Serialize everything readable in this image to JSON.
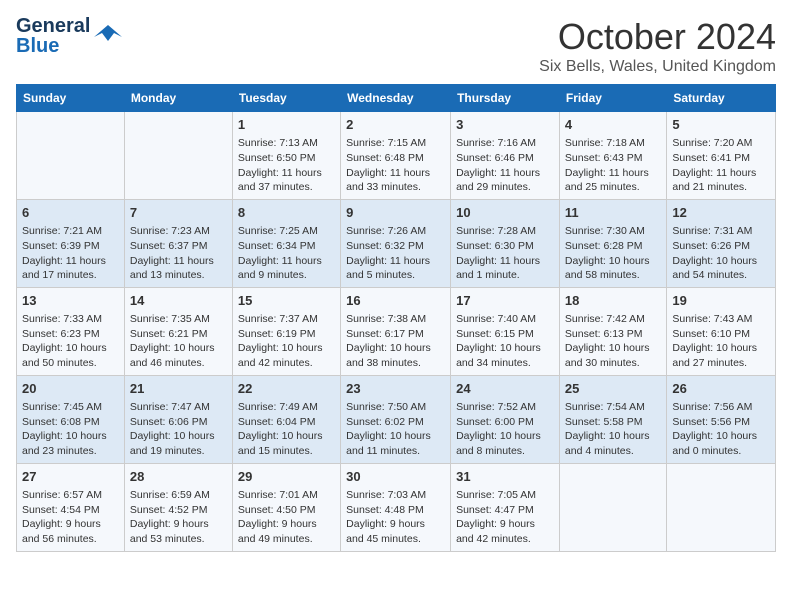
{
  "logo": {
    "line1": "General",
    "line2": "Blue"
  },
  "title": "October 2024",
  "location": "Six Bells, Wales, United Kingdom",
  "days_of_week": [
    "Sunday",
    "Monday",
    "Tuesday",
    "Wednesday",
    "Thursday",
    "Friday",
    "Saturday"
  ],
  "weeks": [
    [
      {
        "day": "",
        "sunrise": "",
        "sunset": "",
        "daylight": ""
      },
      {
        "day": "",
        "sunrise": "",
        "sunset": "",
        "daylight": ""
      },
      {
        "day": "1",
        "sunrise": "Sunrise: 7:13 AM",
        "sunset": "Sunset: 6:50 PM",
        "daylight": "Daylight: 11 hours and 37 minutes."
      },
      {
        "day": "2",
        "sunrise": "Sunrise: 7:15 AM",
        "sunset": "Sunset: 6:48 PM",
        "daylight": "Daylight: 11 hours and 33 minutes."
      },
      {
        "day": "3",
        "sunrise": "Sunrise: 7:16 AM",
        "sunset": "Sunset: 6:46 PM",
        "daylight": "Daylight: 11 hours and 29 minutes."
      },
      {
        "day": "4",
        "sunrise": "Sunrise: 7:18 AM",
        "sunset": "Sunset: 6:43 PM",
        "daylight": "Daylight: 11 hours and 25 minutes."
      },
      {
        "day": "5",
        "sunrise": "Sunrise: 7:20 AM",
        "sunset": "Sunset: 6:41 PM",
        "daylight": "Daylight: 11 hours and 21 minutes."
      }
    ],
    [
      {
        "day": "6",
        "sunrise": "Sunrise: 7:21 AM",
        "sunset": "Sunset: 6:39 PM",
        "daylight": "Daylight: 11 hours and 17 minutes."
      },
      {
        "day": "7",
        "sunrise": "Sunrise: 7:23 AM",
        "sunset": "Sunset: 6:37 PM",
        "daylight": "Daylight: 11 hours and 13 minutes."
      },
      {
        "day": "8",
        "sunrise": "Sunrise: 7:25 AM",
        "sunset": "Sunset: 6:34 PM",
        "daylight": "Daylight: 11 hours and 9 minutes."
      },
      {
        "day": "9",
        "sunrise": "Sunrise: 7:26 AM",
        "sunset": "Sunset: 6:32 PM",
        "daylight": "Daylight: 11 hours and 5 minutes."
      },
      {
        "day": "10",
        "sunrise": "Sunrise: 7:28 AM",
        "sunset": "Sunset: 6:30 PM",
        "daylight": "Daylight: 11 hours and 1 minute."
      },
      {
        "day": "11",
        "sunrise": "Sunrise: 7:30 AM",
        "sunset": "Sunset: 6:28 PM",
        "daylight": "Daylight: 10 hours and 58 minutes."
      },
      {
        "day": "12",
        "sunrise": "Sunrise: 7:31 AM",
        "sunset": "Sunset: 6:26 PM",
        "daylight": "Daylight: 10 hours and 54 minutes."
      }
    ],
    [
      {
        "day": "13",
        "sunrise": "Sunrise: 7:33 AM",
        "sunset": "Sunset: 6:23 PM",
        "daylight": "Daylight: 10 hours and 50 minutes."
      },
      {
        "day": "14",
        "sunrise": "Sunrise: 7:35 AM",
        "sunset": "Sunset: 6:21 PM",
        "daylight": "Daylight: 10 hours and 46 minutes."
      },
      {
        "day": "15",
        "sunrise": "Sunrise: 7:37 AM",
        "sunset": "Sunset: 6:19 PM",
        "daylight": "Daylight: 10 hours and 42 minutes."
      },
      {
        "day": "16",
        "sunrise": "Sunrise: 7:38 AM",
        "sunset": "Sunset: 6:17 PM",
        "daylight": "Daylight: 10 hours and 38 minutes."
      },
      {
        "day": "17",
        "sunrise": "Sunrise: 7:40 AM",
        "sunset": "Sunset: 6:15 PM",
        "daylight": "Daylight: 10 hours and 34 minutes."
      },
      {
        "day": "18",
        "sunrise": "Sunrise: 7:42 AM",
        "sunset": "Sunset: 6:13 PM",
        "daylight": "Daylight: 10 hours and 30 minutes."
      },
      {
        "day": "19",
        "sunrise": "Sunrise: 7:43 AM",
        "sunset": "Sunset: 6:10 PM",
        "daylight": "Daylight: 10 hours and 27 minutes."
      }
    ],
    [
      {
        "day": "20",
        "sunrise": "Sunrise: 7:45 AM",
        "sunset": "Sunset: 6:08 PM",
        "daylight": "Daylight: 10 hours and 23 minutes."
      },
      {
        "day": "21",
        "sunrise": "Sunrise: 7:47 AM",
        "sunset": "Sunset: 6:06 PM",
        "daylight": "Daylight: 10 hours and 19 minutes."
      },
      {
        "day": "22",
        "sunrise": "Sunrise: 7:49 AM",
        "sunset": "Sunset: 6:04 PM",
        "daylight": "Daylight: 10 hours and 15 minutes."
      },
      {
        "day": "23",
        "sunrise": "Sunrise: 7:50 AM",
        "sunset": "Sunset: 6:02 PM",
        "daylight": "Daylight: 10 hours and 11 minutes."
      },
      {
        "day": "24",
        "sunrise": "Sunrise: 7:52 AM",
        "sunset": "Sunset: 6:00 PM",
        "daylight": "Daylight: 10 hours and 8 minutes."
      },
      {
        "day": "25",
        "sunrise": "Sunrise: 7:54 AM",
        "sunset": "Sunset: 5:58 PM",
        "daylight": "Daylight: 10 hours and 4 minutes."
      },
      {
        "day": "26",
        "sunrise": "Sunrise: 7:56 AM",
        "sunset": "Sunset: 5:56 PM",
        "daylight": "Daylight: 10 hours and 0 minutes."
      }
    ],
    [
      {
        "day": "27",
        "sunrise": "Sunrise: 6:57 AM",
        "sunset": "Sunset: 4:54 PM",
        "daylight": "Daylight: 9 hours and 56 minutes."
      },
      {
        "day": "28",
        "sunrise": "Sunrise: 6:59 AM",
        "sunset": "Sunset: 4:52 PM",
        "daylight": "Daylight: 9 hours and 53 minutes."
      },
      {
        "day": "29",
        "sunrise": "Sunrise: 7:01 AM",
        "sunset": "Sunset: 4:50 PM",
        "daylight": "Daylight: 9 hours and 49 minutes."
      },
      {
        "day": "30",
        "sunrise": "Sunrise: 7:03 AM",
        "sunset": "Sunset: 4:48 PM",
        "daylight": "Daylight: 9 hours and 45 minutes."
      },
      {
        "day": "31",
        "sunrise": "Sunrise: 7:05 AM",
        "sunset": "Sunset: 4:47 PM",
        "daylight": "Daylight: 9 hours and 42 minutes."
      },
      {
        "day": "",
        "sunrise": "",
        "sunset": "",
        "daylight": ""
      },
      {
        "day": "",
        "sunrise": "",
        "sunset": "",
        "daylight": ""
      }
    ]
  ]
}
